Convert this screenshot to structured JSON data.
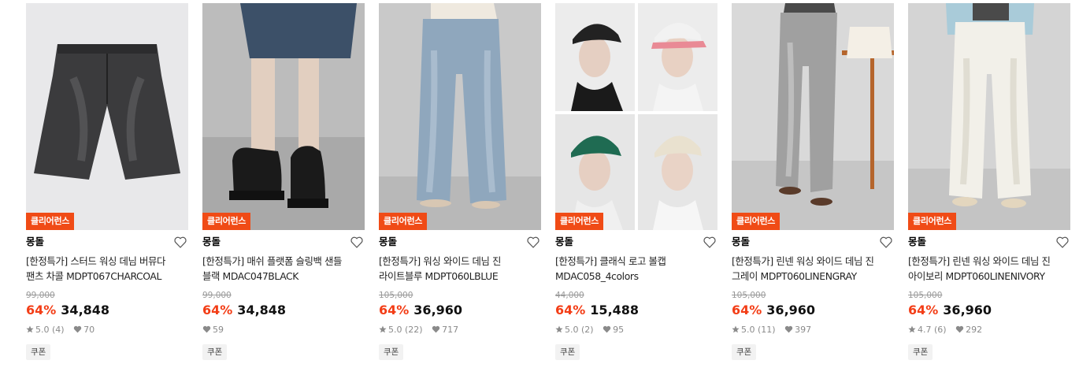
{
  "products": [
    {
      "badge": "클리어런스",
      "brand": "몽돌",
      "name_line1": "[한정특가] 스터드 워싱 데님 버뮤다",
      "name_line2": "팬츠 차콜 MDPT067CHARCOAL",
      "original_price": "99,000",
      "discount": "64%",
      "price": "34,848",
      "rating": "5.0 (4)",
      "likes": "70",
      "coupon": "쿠폰",
      "image_icon": "charcoal-denim-shorts",
      "image_colors": {
        "bg": "#e9e9ea",
        "item": "#3a3a3c"
      }
    },
    {
      "badge": "클리어런스",
      "brand": "몽돌",
      "name_line1": "[한정특가] 매쉬 플랫폼 슬링백 샌들",
      "name_line2": "블랙 MDAC047BLACK",
      "original_price": "99,000",
      "discount": "64%",
      "price": "34,848",
      "rating": "",
      "likes": "59",
      "coupon": "쿠폰",
      "image_icon": "black-platform-sandals",
      "image_colors": {
        "bg": "#bdbdbd",
        "item": "#1d1d1d"
      }
    },
    {
      "badge": "클리어런스",
      "brand": "몽돌",
      "name_line1": "[한정특가] 워싱 와이드 데님 진",
      "name_line2": "라이트블루 MDPT060LBLUE",
      "original_price": "105,000",
      "discount": "64%",
      "price": "36,960",
      "rating": "5.0 (22)",
      "likes": "717",
      "coupon": "쿠폰",
      "image_icon": "light-blue-wide-jeans",
      "image_colors": {
        "bg": "#c8c8c8",
        "item": "#8fa6bd"
      }
    },
    {
      "badge": "클리어런스",
      "brand": "몽돌",
      "name_line1": "[한정특가] 클래식 로고 볼캡",
      "name_line2": "MDAC058_4colors",
      "original_price": "44,000",
      "discount": "64%",
      "price": "15,488",
      "rating": "5.0 (2)",
      "likes": "95",
      "coupon": "쿠폰",
      "image_icon": "logo-ball-caps-four-colors",
      "image_colors": {
        "bg": "#eeeeee",
        "item": "#2b2b2b"
      }
    },
    {
      "badge": "클리어런스",
      "brand": "몽돌",
      "name_line1": "[한정특가] 린넨 워싱 와이드 데님 진",
      "name_line2": "그레이 MDPT060LINENGRAY",
      "original_price": "105,000",
      "discount": "64%",
      "price": "36,960",
      "rating": "5.0 (11)",
      "likes": "397",
      "coupon": "쿠폰",
      "image_icon": "gray-wide-jeans",
      "image_colors": {
        "bg": "#d7d7d7",
        "item": "#9b9b9b"
      }
    },
    {
      "badge": "클리어런스",
      "brand": "몽돌",
      "name_line1": "[한정특가] 린넨 워싱 와이드 데님 진",
      "name_line2": "아이보리 MDPT060LINENIVORY",
      "original_price": "105,000",
      "discount": "64%",
      "price": "36,960",
      "rating": "4.7 (6)",
      "likes": "292",
      "coupon": "쿠폰",
      "image_icon": "ivory-wide-jeans",
      "image_colors": {
        "bg": "#d4d4d4",
        "item": "#f1efe8"
      }
    }
  ],
  "colors": {
    "badge": "#f04b16",
    "discount": "#f33d16",
    "muted": "#999999"
  }
}
